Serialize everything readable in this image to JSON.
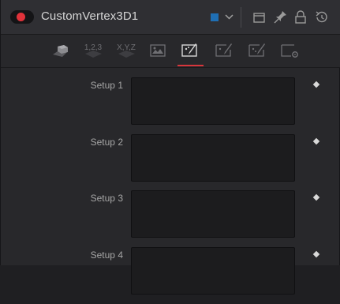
{
  "header": {
    "title": "CustomVertex3D1",
    "color_swatch": "#1f6fb4",
    "icons": [
      "color-swatch-icon",
      "chevron-down-icon",
      "window-icon",
      "pin-icon",
      "lock-icon",
      "reset-icon"
    ]
  },
  "tabs": [
    {
      "name": "3d-cube-icon"
    },
    {
      "name": "numbers-tab",
      "label": "1,2,3"
    },
    {
      "name": "xyz-tab",
      "label": "X,Y,Z"
    },
    {
      "name": "image-icon"
    },
    {
      "name": "brush-icon",
      "active": true
    },
    {
      "name": "brush-icon-2"
    },
    {
      "name": "brush-icon-3"
    },
    {
      "name": "settings-icon"
    }
  ],
  "rows": [
    {
      "label": "Setup 1"
    },
    {
      "label": "Setup 2"
    },
    {
      "label": "Setup 3"
    },
    {
      "label": "Setup 4"
    }
  ],
  "colors": {
    "accent": "#d8363c",
    "power": "#e0323a"
  }
}
